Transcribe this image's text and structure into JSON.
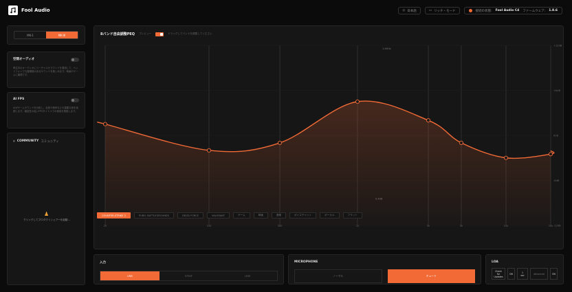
{
  "app": {
    "title": "Fool Audio"
  },
  "header": {
    "pill1": "日本語",
    "pill2": "リッチ・モード",
    "status_prefix": "接続の状態:",
    "status_device": "Fool Audio C4",
    "status_version_label": "ファームウェア:",
    "status_version": "1.8.6"
  },
  "mode_switch": {
    "options": [
      "MK-1",
      "MK-III"
    ],
    "selected_index": 1
  },
  "cards": [
    {
      "title": "空間オーディオ",
      "body": "再生中のオーディオにバーチャルサラウンドを適用して、ヘッドフォンでも臨場感のあるサウンドを楽しめます。映画やゲームに最適です。"
    },
    {
      "title": "AI FPS",
      "body": "AIがゲームサウンドを分析し、足音や銃声などの重要な音を強調します。競技性の高いFPSタイトルでの使用を推奨します。"
    }
  ],
  "community": {
    "title": "COMMUNITY",
    "subtitle": "コミュニティ",
    "message": "クリックしてプロダクトシェアーを起動..."
  },
  "eq": {
    "title": "8バンド自由調整PEQ",
    "sub1": "プレビュー",
    "sub2": "ドラッグしてバンドを調整してください",
    "top_label": "1.4KHz",
    "mid_label": "0.4dB",
    "y_ticks": [
      "+12dB",
      "+6dB",
      "0dB",
      "-6dB",
      "-12dB"
    ],
    "x_ticks": [
      "20",
      "100",
      "300",
      "1k",
      "3k",
      "5k",
      "10k",
      "20k"
    ]
  },
  "presets": {
    "items": [
      "COUNTER-STRIKE 2",
      "PUBG: BATTLEGROUNDS",
      "DELTA FORCE",
      "VALORANT",
      "ゲーム",
      "映画",
      "音楽",
      "ボイスチャット",
      "ボーカル",
      "フラット"
    ],
    "selected_index": 0
  },
  "input": {
    "label": "入力",
    "options": [
      "USB",
      "SPDIF",
      "LINE"
    ],
    "selected_index": 0
  },
  "microphone": {
    "label": "MICROPHONE",
    "options": [
      "ノーマル",
      "ミュート"
    ],
    "selected_index": 1
  },
  "loa": {
    "label": "LOA",
    "update": "Check for Updates",
    "stat": "ON",
    "code": "1 sec",
    "adv": "Advanced",
    "adv_value": "ON"
  },
  "chart_data": {
    "type": "line",
    "title": "8バンド自由調整PEQ",
    "x": [
      20,
      100,
      300,
      1000,
      3000,
      5000,
      10000,
      20000
    ],
    "series": [
      {
        "values": [
          1.5,
          -2.0,
          -1.0,
          4.5,
          2.0,
          -1.0,
          -3.0,
          -2.5
        ]
      }
    ],
    "ylim": [
      -12,
      12
    ],
    "log_x": true,
    "grid": true
  },
  "colors": {
    "accent": "#f26a36",
    "background": "#0b0b0b",
    "panel": "#161616"
  }
}
